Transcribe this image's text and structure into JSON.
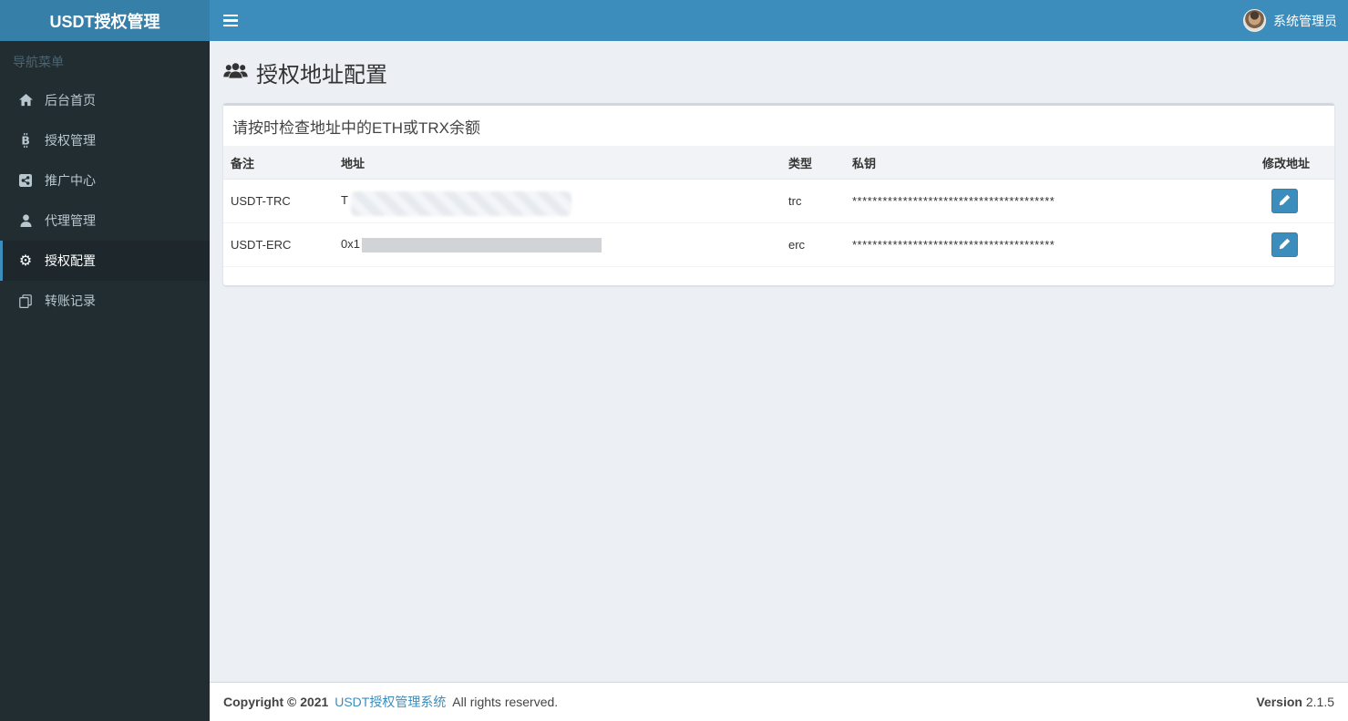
{
  "header": {
    "logo": "USDT授权管理",
    "user": {
      "name": "系统管理员"
    }
  },
  "sidebar": {
    "section_label": "导航菜单",
    "items": [
      {
        "label": "后台首页",
        "icon": "home-icon",
        "active": false
      },
      {
        "label": "授权管理",
        "icon": "bitcoin-icon",
        "active": false
      },
      {
        "label": "推广中心",
        "icon": "share-square-icon",
        "active": false
      },
      {
        "label": "代理管理",
        "icon": "user-icon",
        "active": false
      },
      {
        "label": "授权配置",
        "icon": "gear-icon",
        "active": true
      },
      {
        "label": "转账记录",
        "icon": "copy-icon",
        "active": false
      }
    ]
  },
  "page": {
    "title": "授权地址配置",
    "title_icon": "users-icon"
  },
  "panel": {
    "header": "请按时检查地址中的ETH或TRX余额",
    "table": {
      "columns": [
        "备注",
        "地址",
        "类型",
        "私钥",
        "修改地址"
      ],
      "rows": [
        {
          "remark": "USDT-TRC",
          "address_prefix": "T",
          "address_redacted": "blurred",
          "type": "trc",
          "private_key": "****************************************",
          "action_icon": "pencil-icon"
        },
        {
          "remark": "USDT-ERC",
          "address_prefix": "0x1",
          "address_redacted": "solid-bar",
          "type": "erc",
          "private_key": "****************************************",
          "action_icon": "pencil-icon"
        }
      ]
    }
  },
  "footer": {
    "copyright": "Copyright © 2021",
    "brand_link": "USDT授权管理系统",
    "rights": "All rights reserved.",
    "version_label": "Version",
    "version_value": "2.1.5"
  },
  "colors": {
    "navbar_bg": "#3c8dbc",
    "logo_bg": "#367fa9",
    "sidebar_bg": "#222d32",
    "sidebar_active_bg": "#1e282c",
    "sidebar_active_border": "#3c8dbc",
    "sidebar_text": "#b8c7ce",
    "content_bg": "#ecf0f5",
    "button_bg": "#3c8dbc",
    "link": "#3c8dbc"
  }
}
